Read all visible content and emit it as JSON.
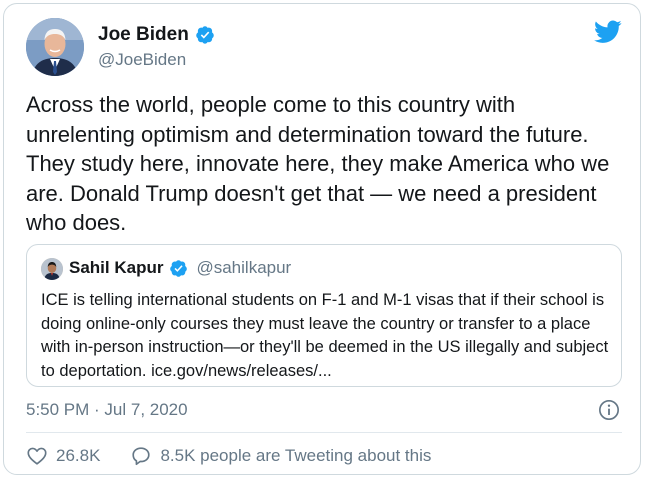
{
  "tweet": {
    "author_name": "Joe Biden",
    "author_handle": "@JoeBiden",
    "text": "Across the world, people come to this country with unrelenting optimism and determination toward the future. They study here, innovate here, they make America who we are. Donald Trump doesn't get that — we need a president who does.",
    "timestamp": "5:50 PM · Jul 7, 2020",
    "likes": "26.8K",
    "conversation": "8.5K people are Tweeting about this"
  },
  "quoted_tweet": {
    "author_name": "Sahil Kapur",
    "author_handle": "@sahilkapur",
    "text": "ICE is telling international students on F-1 and M-1 visas that if their school is doing online-only courses they must leave the country or transfer to a place with in-person instruction—or they'll be deemed in the US illegally and subject to deportation. ice.gov/news/releases/..."
  },
  "icons": {
    "verified": "verified-badge-icon",
    "logo": "twitter-bird-icon",
    "info": "info-icon",
    "like": "heart-icon",
    "reply": "speech-bubble-icon"
  },
  "colors": {
    "brand": "#1da1f2",
    "text": "#14171a",
    "secondary": "#657786",
    "border": "#cfd9de"
  }
}
